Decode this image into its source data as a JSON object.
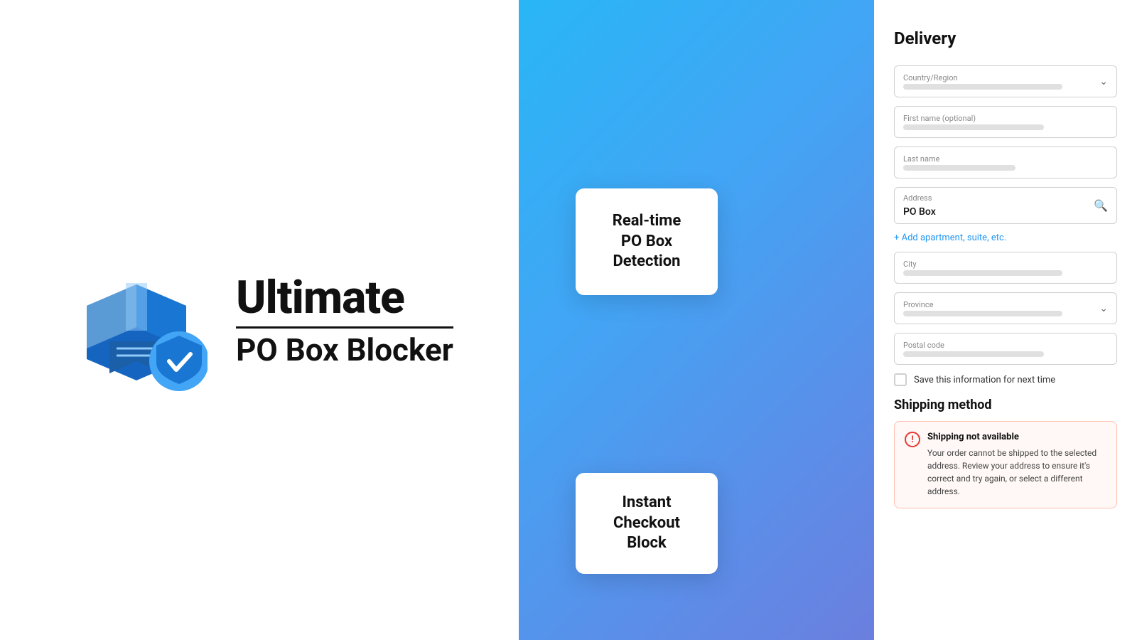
{
  "left": {
    "logo_title": "Ultimate",
    "logo_subtitle": "PO Box Blocker"
  },
  "cards": {
    "detection": {
      "line1": "Real-time",
      "line2": "PO Box",
      "line3": "Detection"
    },
    "checkout": {
      "line1": "Instant",
      "line2": "Checkout Block"
    }
  },
  "form": {
    "title": "Delivery",
    "country_label": "Country/Region",
    "first_name_label": "First name (optional)",
    "last_name_label": "Last name",
    "address_label": "Address",
    "address_value": "PO Box",
    "add_apartment_label": "+ Add apartment, suite, etc.",
    "city_label": "City",
    "province_label": "Province",
    "postal_code_label": "Postal code",
    "save_label": "Save this information for next time",
    "shipping_method_title": "Shipping method",
    "error_title": "Shipping not available",
    "error_body": "Your order cannot be shipped to the selected address. Review your address to ensure it's correct and try again, or select a different address."
  }
}
